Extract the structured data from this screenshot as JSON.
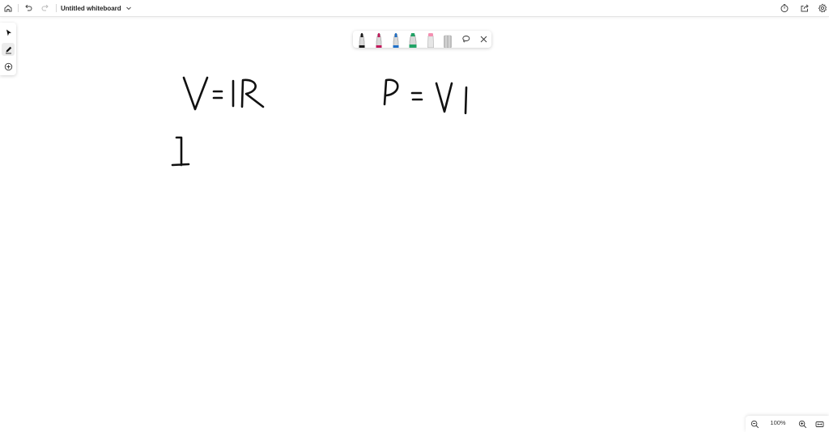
{
  "header": {
    "title": "Untitled whiteboard",
    "icons": [
      "home-icon",
      "undo-icon",
      "redo-icon",
      "chevron-down-icon",
      "timer-icon",
      "share-icon",
      "settings-icon"
    ]
  },
  "left_toolbar": {
    "tools": [
      "select-tool",
      "pen-tool",
      "add-tool"
    ],
    "active_tool": "pen-tool"
  },
  "pen_toolbar": {
    "pens": [
      {
        "name": "black-pen",
        "color": "#1a1a1a"
      },
      {
        "name": "pink-pen",
        "color": "#c2185b"
      },
      {
        "name": "blue-pen",
        "color": "#1e6fc8"
      },
      {
        "name": "green-highlighter",
        "color": "#21a366"
      },
      {
        "name": "pink-highlighter",
        "color": "#f48fb1"
      },
      {
        "name": "eraser",
        "color": "#bdbdbd"
      }
    ],
    "icons": [
      "lasso-icon",
      "close-icon"
    ]
  },
  "zoom": {
    "level": "100%"
  },
  "colors": {
    "background": "#ffffff",
    "ink": "#111111"
  }
}
